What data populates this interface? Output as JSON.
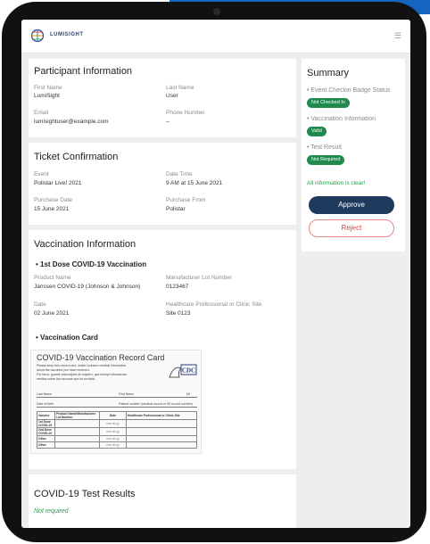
{
  "app": {
    "brand": "LUMISIGHT"
  },
  "participant": {
    "heading": "Participant Information",
    "first_name_label": "First Name",
    "first_name": "LumiSight",
    "last_name_label": "Last Name",
    "last_name": "User",
    "email_label": "Email",
    "email": "lumisightuser@example.com",
    "phone_label": "Phone Number",
    "phone": "–"
  },
  "ticket": {
    "heading": "Ticket Confirmation",
    "event_label": "Event",
    "event": "Polistar Live! 2021",
    "datetime_label": "Date Time",
    "datetime": "9 AM at 15 June 2021",
    "purchase_date_label": "Purchase Date",
    "purchase_date": "15 June 2021",
    "purchase_from_label": "Purchase From",
    "purchase_from": "Polistar"
  },
  "vaccination": {
    "heading": "Vaccination Information",
    "dose_title": "• 1st Dose COVID-19 Vaccination",
    "product_label": "Product Name",
    "product": "Janssen COVID-19 (Johnson & Johnson)",
    "lot_label": "Manufacturer Lot Number",
    "lot": "0123467",
    "date_label": "Date",
    "date": "02 June 2021",
    "site_label": "Healthcare Professional or Clinic Site",
    "site": "Site 0123",
    "card_title": "• Vaccination Card",
    "record_card": {
      "title": "COVID-19 Vaccination Record Card",
      "note1": "Please keep this record card, which includes medical information",
      "note2": "about the vaccines you have received.",
      "note3": "Por favor, guarde esta tarjeta de registro, que incluye información",
      "note4": "médica sobre las vacunas que ha recibido.",
      "last_name": "Last Name",
      "first_name": "First Name",
      "mi": "MI",
      "dob": "Date of birth",
      "patient_number": "Patient number (medical record or IIS record number)",
      "col_vaccine": "Vaccine",
      "col_product": "Product Name/Manufacturer Lot Number",
      "col_date": "Date",
      "col_site": "Healthcare Professional or Clinic Site",
      "row1": "1st Dose COVID-19",
      "row2": "2nd Dose COVID-19",
      "row3": "Other",
      "row4": "Other",
      "date_hint": "mm  dd  yy",
      "cdc": "CDC"
    }
  },
  "test": {
    "heading": "COVID-19 Test Results",
    "status": "Not required"
  },
  "summary": {
    "heading": "Summary",
    "checkin_label": "• Event Checkin Badge Status",
    "checkin_badge": "Not Checked In",
    "vacc_label": "• Vaccination Information",
    "vacc_badge": "Valid",
    "test_label": "• Test Result",
    "test_badge": "Not Required",
    "clear_msg": "All information is clear!",
    "approve": "Approve",
    "reject": "Reject"
  },
  "colors": {
    "approve": "#1e3a5c",
    "badge": "#1f8a4c",
    "reject": "#d64545",
    "brand": "#2e3f7f"
  }
}
